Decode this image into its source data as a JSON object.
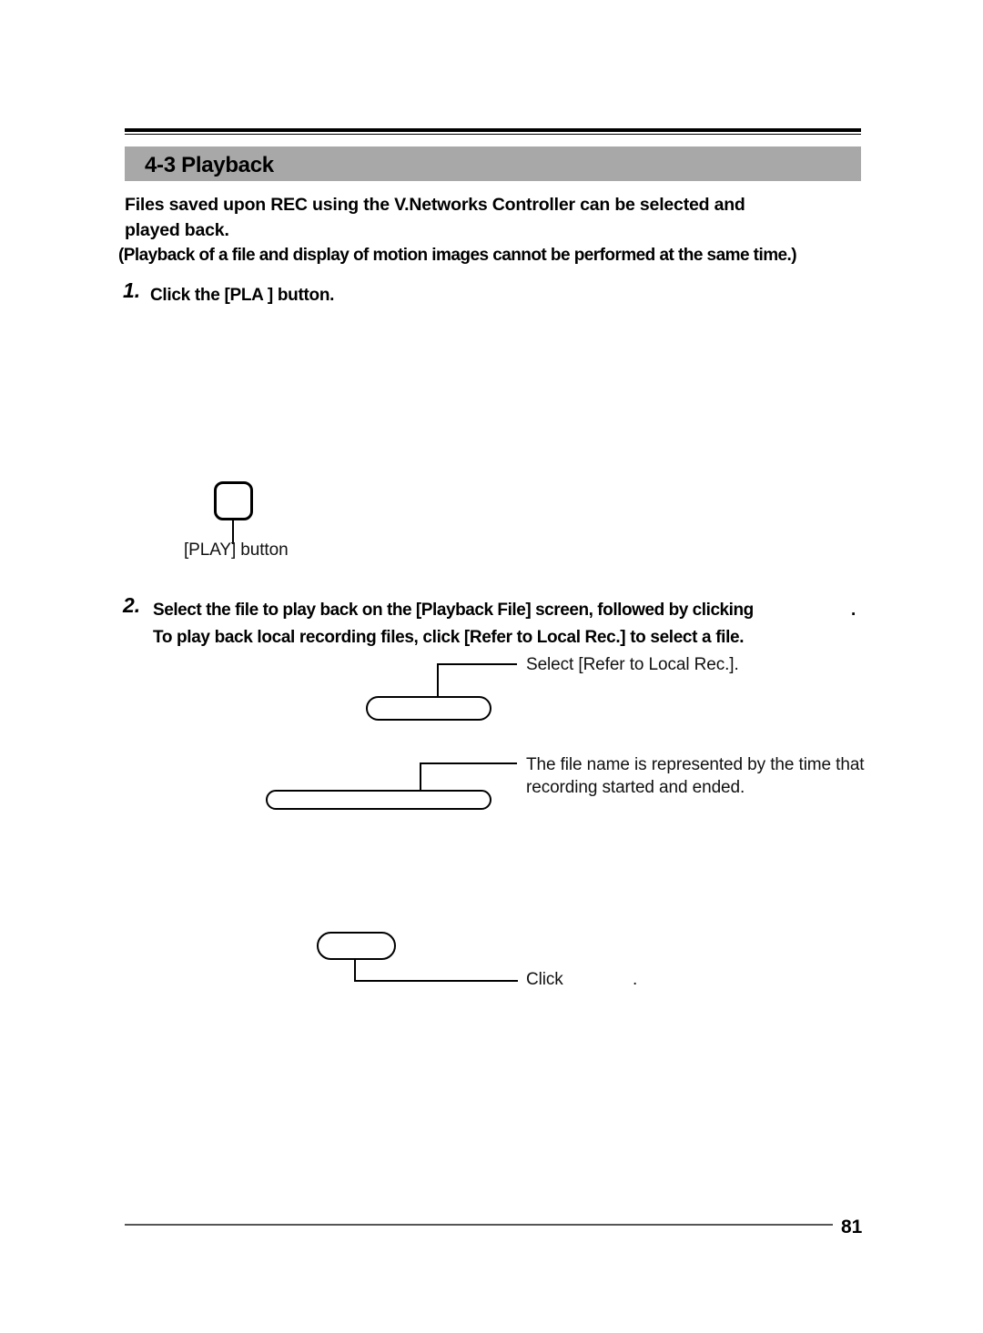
{
  "document": {
    "section_number": "4-3",
    "section_title": "4-3 Playback",
    "page_number": "81"
  },
  "intro": {
    "line1": "Files saved upon  REC  using the  V.Networks Controller  can be selected and",
    "line2": "played back.",
    "note": "(Playback of a file and display of motion images cannot be performed at the same time.)"
  },
  "steps": [
    {
      "number": "1.",
      "text": "Click the [PLA  ] button."
    },
    {
      "number": "2.",
      "line1": "Select the file to play back on the [Playback File] screen, followed by clicking",
      "line1_trailing": ".",
      "line2": "To play back local recording files, click [Refer to Local Rec.] to select a file."
    }
  ],
  "callouts": [
    {
      "id": "play-button",
      "label": "[PLAY] button"
    },
    {
      "id": "refer-local-rec",
      "label": "Select [Refer to Local Rec.]."
    },
    {
      "id": "file-name",
      "label_line1": "The file name is represented by the time that",
      "label_line2": "recording started and ended."
    },
    {
      "id": "click-button",
      "label": "Click",
      "label_trailing": "."
    }
  ],
  "colors": {
    "section_bar": "#a8a8a8",
    "rule": "#000000",
    "footer_rule": "#555555",
    "text": "#000000"
  }
}
